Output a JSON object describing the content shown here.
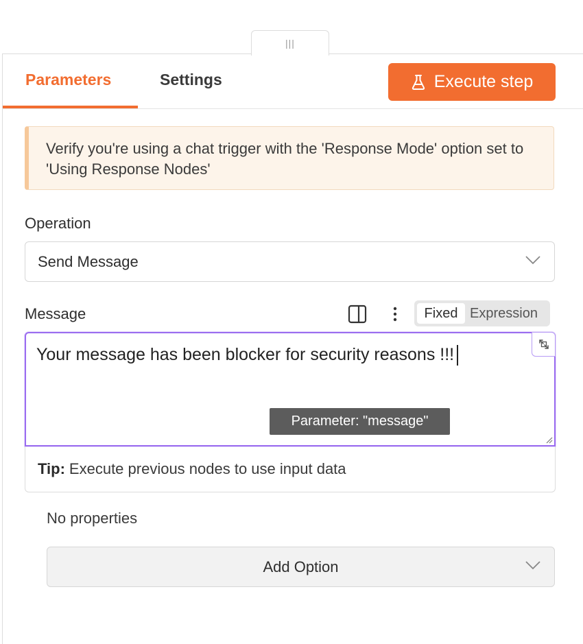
{
  "drag_handle": {
    "glyph": "|||"
  },
  "tabs": [
    {
      "label": "Parameters",
      "active": true
    },
    {
      "label": "Settings",
      "active": false
    }
  ],
  "execute_button": {
    "label": "Execute step",
    "icon": "flask-icon"
  },
  "notice": {
    "text": "Verify you're using a chat trigger with the 'Response Mode' option set to 'Using Response Nodes'"
  },
  "operation": {
    "label": "Operation",
    "value": "Send Message"
  },
  "message": {
    "label": "Message",
    "mode_options": [
      "Fixed",
      "Expression"
    ],
    "selected_mode": "Fixed",
    "value": "Your message has been blocker for security reasons !!!",
    "tooltip": "Parameter: \"message\""
  },
  "tip": {
    "prefix": "Tip:",
    "text": "Execute previous nodes to use input data"
  },
  "options": {
    "empty_text": "No properties",
    "add_label": "Add Option"
  },
  "colors": {
    "accent": "#f26d30",
    "focus": "#9a6cf0",
    "notice_bg": "#fdf4ea"
  }
}
